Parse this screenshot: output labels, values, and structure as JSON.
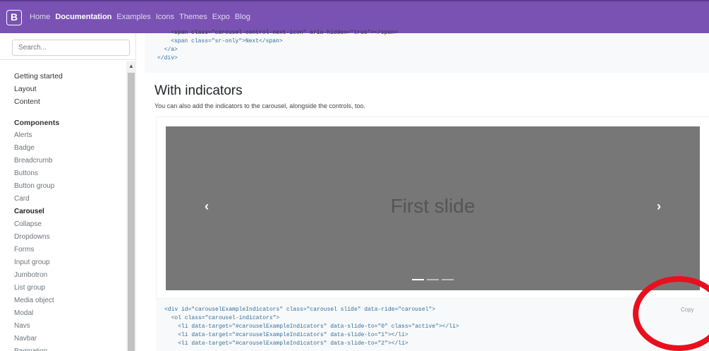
{
  "topbar": {
    "brand": "B",
    "nav": [
      "Home",
      "Documentation",
      "Examples",
      "Icons",
      "Themes",
      "Expo",
      "Blog"
    ],
    "active": "Documentation",
    "color": "#7952b3"
  },
  "sidebar": {
    "search_placeholder": "Search...",
    "top_items": [
      "Getting started",
      "Layout",
      "Content"
    ],
    "section_heading": "Components",
    "items": [
      "Alerts",
      "Badge",
      "Breadcrumb",
      "Buttons",
      "Button group",
      "Card",
      "Carousel",
      "Collapse",
      "Dropdowns",
      "Forms",
      "Input group",
      "Jumbotron",
      "List group",
      "Media object",
      "Modal",
      "Navs",
      "Navbar",
      "Pagination"
    ],
    "current": "Carousel"
  },
  "code_top": {
    "line1": "    <span class=\"carousel-control-next-icon\" aria-hidden=\"true\"></span>",
    "line2": "    <span class=\"sr-only\">Next</span>",
    "line3": "  </a>",
    "line4": "</div>"
  },
  "section": {
    "title": "With indicators",
    "lead": "You can also add the indicators to the carousel, alongside the controls, too."
  },
  "carousel": {
    "slide_text": "First slide",
    "prev_icon": "chevron-left-icon",
    "next_icon": "chevron-right-icon",
    "indicator_count": 3,
    "active_index": 0
  },
  "code_bottom": {
    "line1": "<div id=\"carouselExampleIndicators\" class=\"carousel slide\" data-ride=\"carousel\">",
    "line2": "  <ol class=\"carousel-indicators\">",
    "line3": "    <li data-target=\"#carouselExampleIndicators\" data-slide-to=\"0\" class=\"active\"></li>",
    "line4": "    <li data-target=\"#carouselExampleIndicators\" data-slide-to=\"1\"></li>",
    "line5": "    <li data-target=\"#carouselExampleIndicators\" data-slide-to=\"2\"></li>",
    "copy_label": "Copy"
  },
  "annotation": {
    "color": "#e8101e",
    "shape": "circle"
  }
}
